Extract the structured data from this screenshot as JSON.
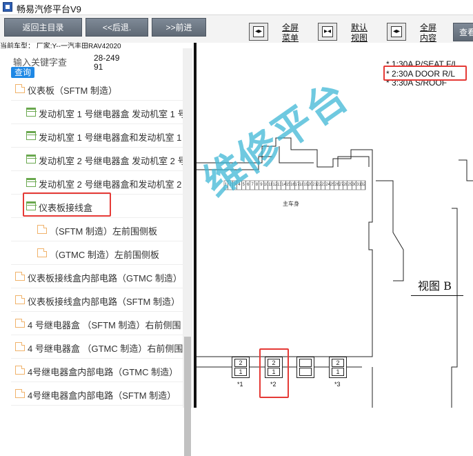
{
  "window": {
    "title": "畅易汽修平台V9"
  },
  "toolbar": {
    "back_home": "返回主目录",
    "back": "<<后退.",
    "forward": ">>前进",
    "fullscreen_menu": [
      "全屏",
      "菜单"
    ],
    "default_view": [
      "默认",
      "视图"
    ],
    "fullscreen_content": [
      "全屏",
      "内容"
    ],
    "search_button": "查看"
  },
  "car_model": "当前车型： 厂家:Y--一汽丰田RAV42020",
  "search": {
    "placeholder": "输入关键字查",
    "query_button": "查询",
    "value": "28-24991"
  },
  "tree": [
    {
      "label": "仪表板（SFTM 制造）",
      "icon": "doc-icon",
      "indent": 0
    },
    {
      "label": "发动机室 1 号继电器盒 发动机室 1 号",
      "icon": "folder-open-icon",
      "indent": 1
    },
    {
      "label": "发动机室 1 号继电器盒和发动机室 1",
      "icon": "folder-open-icon",
      "indent": 1
    },
    {
      "label": "发动机室 2 号继电器盒 发动机室 2 号",
      "icon": "folder-open-icon",
      "indent": 1
    },
    {
      "label": "发动机室 2 号继电器盒和发动机室 2",
      "icon": "folder-open-icon",
      "indent": 1
    },
    {
      "label": "仪表板接线盒",
      "icon": "folder-open-icon",
      "indent": 1
    },
    {
      "label": "（SFTM 制造）左前围侧板",
      "icon": "doc-icon",
      "indent": 2
    },
    {
      "label": "（GTMC 制造）左前围侧板",
      "icon": "doc-icon",
      "indent": 2
    },
    {
      "label": "仪表板接线盒内部电路（GTMC 制造）",
      "icon": "doc-icon",
      "indent": 0
    },
    {
      "label": "仪表板接线盒内部电路（SFTM 制造）",
      "icon": "doc-icon",
      "indent": 0
    },
    {
      "label": "4 号继电器盒 （SFTM 制造）右前侧围",
      "icon": "doc-icon",
      "indent": 0
    },
    {
      "label": "4 号继电器盒 （GTMC 制造）右前侧围",
      "icon": "doc-icon",
      "indent": 0
    },
    {
      "label": "4号继电器盒内部电路（GTMC 制造）",
      "icon": "doc-icon",
      "indent": 0
    },
    {
      "label": "4号继电器盒内部电路（SFTM 制造）",
      "icon": "doc-icon",
      "indent": 0
    }
  ],
  "diagram": {
    "fuse_notes": [
      "* 1:30A P/SEAT F/L",
      "* 2:30A DOOR R/L",
      "* 3:30A S/ROOF"
    ],
    "watermark": "维修平台",
    "body_label": "主车身",
    "view_label": "视图 B",
    "connectors": [
      {
        "pins": [
          "2",
          "1"
        ],
        "label": "*1"
      },
      {
        "pins": [
          "2",
          "1"
        ],
        "label": "*2"
      },
      {
        "pins": [
          "",
          ""
        ],
        "label": ""
      },
      {
        "pins": [
          "2",
          "1"
        ],
        "label": "*3"
      }
    ],
    "strip_numbers": [
      "1",
      "2",
      "3",
      "4",
      "5",
      "6",
      "7",
      "8",
      "9",
      "10",
      "11",
      "12",
      "13",
      "14",
      "15",
      "16",
      "17",
      "18",
      "19",
      "20",
      "21",
      "22",
      "23",
      "24",
      "25",
      "26",
      "27",
      "28",
      "29",
      "30",
      "31",
      "32"
    ]
  },
  "colors": {
    "highlight": "#e53935",
    "accent": "#1e88e5",
    "watermark": "#3fb8d6"
  }
}
